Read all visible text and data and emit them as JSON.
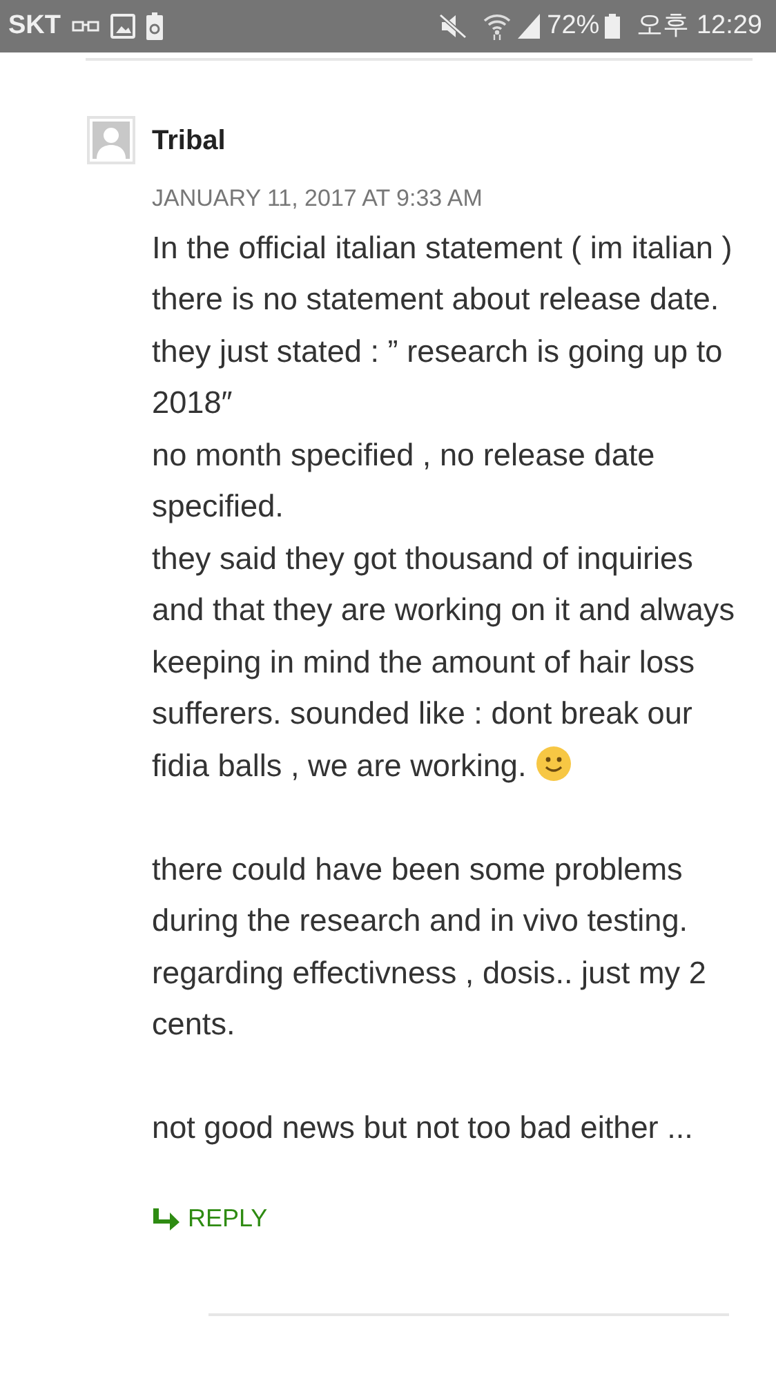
{
  "status_bar": {
    "carrier": "SKT",
    "battery": "72%",
    "time": "오후 12:29"
  },
  "comment": {
    "author": "Tribal",
    "date": "JANUARY 11, 2017 AT 9:33 AM",
    "paragraphs": [
      {
        "lines": [
          {
            "text": "In the official italian statement ( im italian ) there is no statement about release date."
          },
          {
            "text": "they just stated : ” research is going up to 2018″"
          },
          {
            "text": "no month specified , no release date specified."
          },
          {
            "text": "they said they got thousand of inquiries and that they are working on it and always keeping in mind the amount of hair loss sufferers. sounded like : dont break our fidia balls , we are working.",
            "ends_with_smiley": true
          }
        ]
      },
      {
        "lines": [
          {
            "text": "there could have been some problems during the research and in vivo testing. regarding effectivness , dosis.. just my 2 cents."
          }
        ]
      },
      {
        "lines": [
          {
            "text": "not good news but not too bad either ..."
          }
        ]
      }
    ],
    "reply": "REPLY"
  }
}
